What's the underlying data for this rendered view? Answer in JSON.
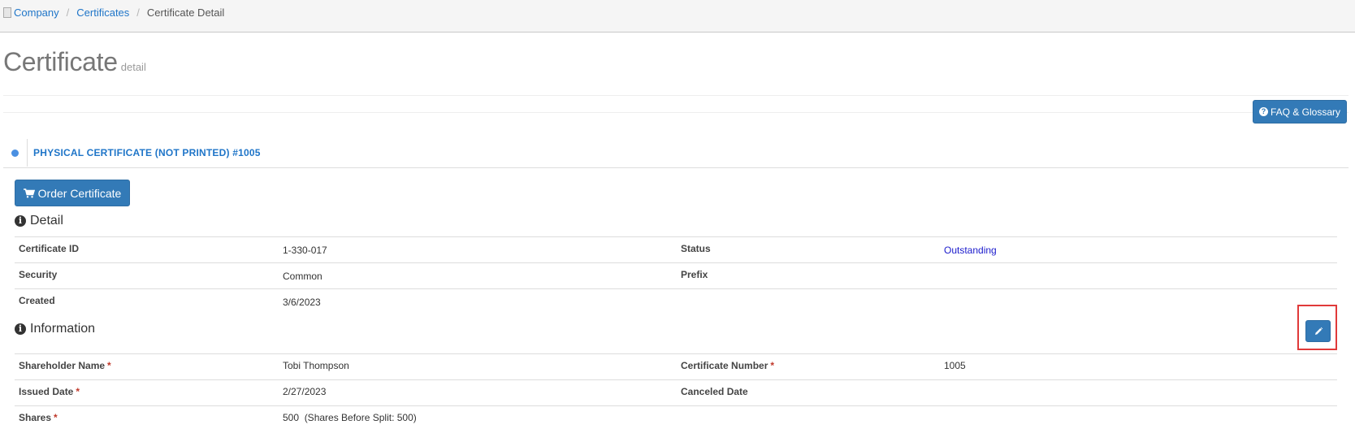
{
  "breadcrumb": {
    "items": [
      "Company",
      "Certificates"
    ],
    "separator": "/",
    "current": "Certificate Detail"
  },
  "page": {
    "title": "Certificate",
    "subtitle": "detail"
  },
  "toolbar": {
    "faq_label": "FAQ & Glossary",
    "faq_icon": "question-circle-icon"
  },
  "certificate_tab": {
    "title": "PHYSICAL CERTIFICATE (NOT PRINTED) #1005"
  },
  "actions": {
    "order_label": "Order Certificate",
    "order_icon": "cart-icon",
    "edit_icon": "pencil-icon"
  },
  "detail": {
    "heading": "Detail",
    "rows": [
      {
        "label1": "Certificate ID",
        "value1": "1-330-017",
        "label2": "Status",
        "value2": "Outstanding"
      },
      {
        "label1": "Security",
        "value1": "Common",
        "label2": "Prefix",
        "value2": ""
      },
      {
        "label1": "Created",
        "value1": "3/6/2023",
        "label2": "",
        "value2": ""
      }
    ]
  },
  "information": {
    "heading": "Information",
    "required_mark": "*",
    "rows": [
      {
        "label1": "Shareholder Name",
        "value1": "Tobi Thompson",
        "label2": "Certificate Number",
        "value2": "1005"
      },
      {
        "label1": "Issued Date",
        "value1": "2/27/2023",
        "label2": "Canceled Date",
        "value2": ""
      },
      {
        "label1": "Shares",
        "value1": "500  (Shares Before Split: 500)",
        "label2": "",
        "value2": ""
      }
    ]
  },
  "colors": {
    "primary_button": "#337ab7",
    "link": "#1f75c8",
    "status_link": "#1a1acc",
    "required": "#c0392b",
    "highlight": "#e03a3a"
  }
}
